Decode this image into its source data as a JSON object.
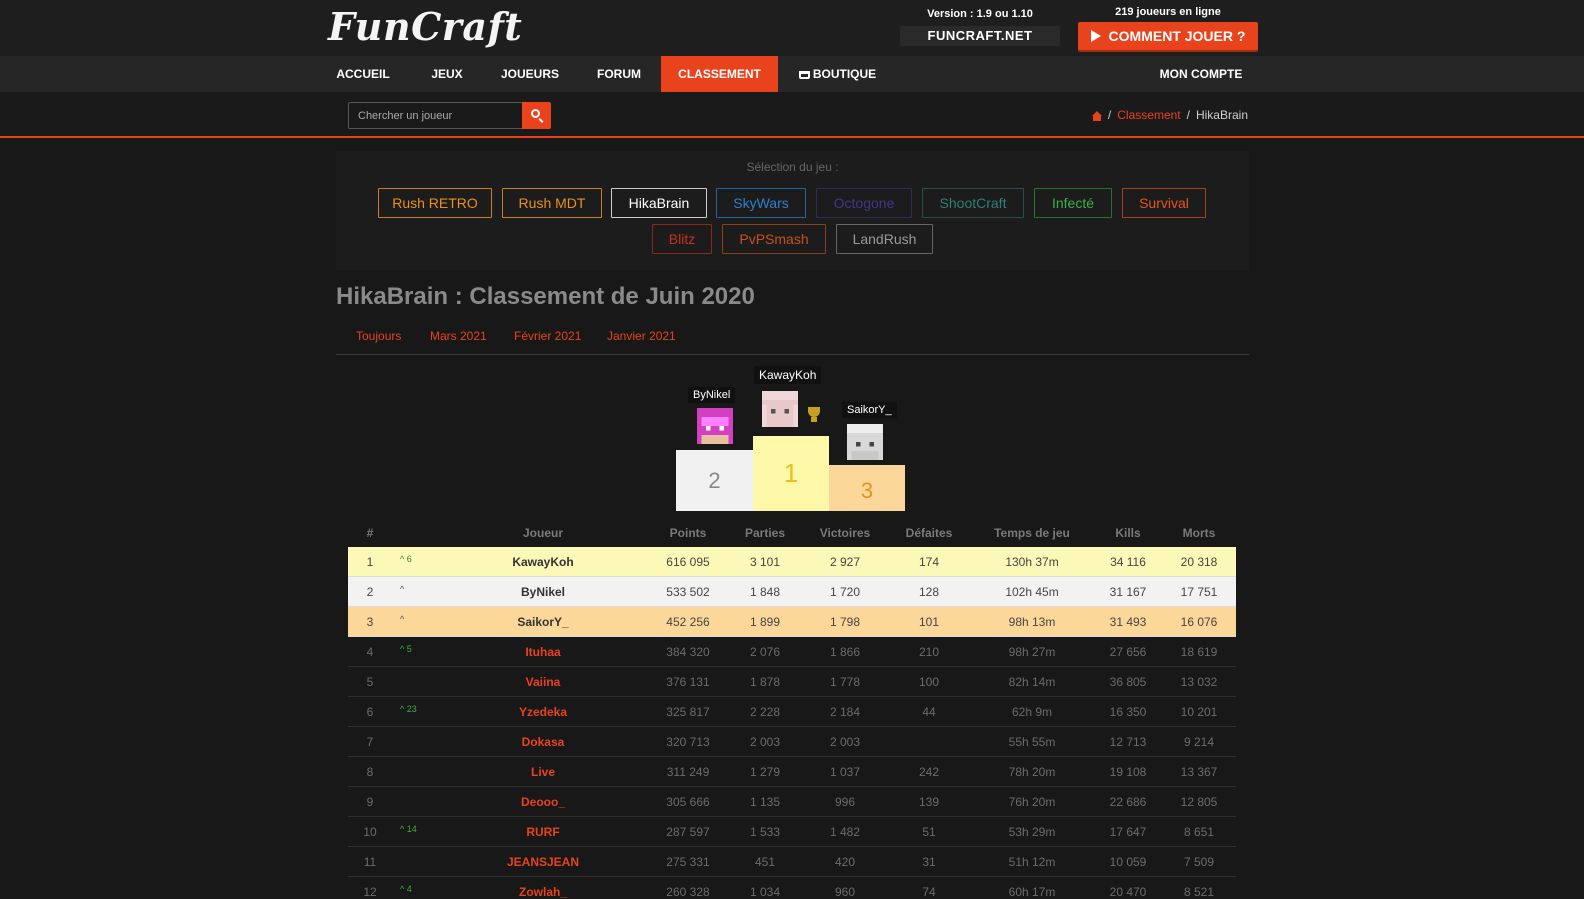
{
  "header": {
    "logo": "FunCraft",
    "version": "Version : 1.9 ou 1.10",
    "server": "FUNCRAFT.NET",
    "online": "219 joueurs en ligne",
    "howto_label": "COMMENT JOUER ?"
  },
  "nav": {
    "items": [
      "ACCUEIL",
      "JEUX",
      "JOUEURS",
      "FORUM",
      "CLASSEMENT",
      "BOUTIQUE"
    ],
    "account": "MON COMPTE"
  },
  "search": {
    "placeholder": "Chercher un joueur"
  },
  "breadcrumb": {
    "level1": "Classement",
    "current": "HikaBrain"
  },
  "games": {
    "label": "Sélection du jeu :",
    "row1": [
      "Rush RETRO",
      "Rush MDT",
      "HikaBrain",
      "SkyWars",
      "Octogone",
      "ShootCraft",
      "Infecté",
      "Survival"
    ],
    "row2": [
      "Blitz",
      "PvPSmash",
      "LandRush"
    ],
    "colors": [
      "#e8901d",
      "#e8901d",
      "#ffffff",
      "#2f7fd0",
      "#3a3a8a",
      "#2f6f6a",
      "#3cb043",
      "#e8431d",
      "#c8301d",
      "#c8501d",
      "#9a9a9a"
    ]
  },
  "title": "HikaBrain : Classement de Juin 2020",
  "periods": [
    "Toujours",
    "Mars 2021",
    "Février 2021",
    "Janvier 2021"
  ],
  "podium": {
    "first": {
      "name": "KawayKoh",
      "rank": "1"
    },
    "second": {
      "name": "ByNikel",
      "rank": "2"
    },
    "third": {
      "name": "SaikorY_",
      "rank": "3"
    }
  },
  "table": {
    "headers": [
      "#",
      "Joueur",
      "Points",
      "Parties",
      "Victoires",
      "Défaites",
      "Temps de jeu",
      "Kills",
      "Morts"
    ],
    "rows": [
      [
        "1",
        "^ 6",
        "KawayKoh",
        "616 095",
        "3 101",
        "2 927",
        "174",
        "130h 37m",
        "34 116",
        "20 318"
      ],
      [
        "2",
        "^",
        "ByNikel",
        "533 502",
        "1 848",
        "1 720",
        "128",
        "102h 45m",
        "31 167",
        "17 751"
      ],
      [
        "3",
        "^",
        "SaikorY_",
        "452 256",
        "1 899",
        "1 798",
        "101",
        "98h 13m",
        "31 493",
        "16 076"
      ],
      [
        "4",
        "^ 5",
        "Ituhaa",
        "384 320",
        "2 076",
        "1 866",
        "210",
        "98h 27m",
        "27 656",
        "18 619"
      ],
      [
        "5",
        "",
        "Vaiina",
        "376 131",
        "1 878",
        "1 778",
        "100",
        "82h 14m",
        "36 805",
        "13 032"
      ],
      [
        "6",
        "^ 23",
        "Yzedeka",
        "325 817",
        "2 228",
        "2 184",
        "44",
        "62h 9m",
        "16 350",
        "10 201"
      ],
      [
        "7",
        "",
        "Dokasa",
        "320 713",
        "2 003",
        "2 003",
        "",
        "55h 55m",
        "12 713",
        "9 214"
      ],
      [
        "8",
        "",
        "Live",
        "311 249",
        "1 279",
        "1 037",
        "242",
        "78h 20m",
        "19 108",
        "13 367"
      ],
      [
        "9",
        "",
        "Deooo_",
        "305 666",
        "1 135",
        "996",
        "139",
        "76h 20m",
        "22 686",
        "12 805"
      ],
      [
        "10",
        "^ 14",
        "RURF",
        "287 597",
        "1 533",
        "1 482",
        "51",
        "53h 29m",
        "17 647",
        "8 651"
      ],
      [
        "11",
        "",
        "JEANSJEAN",
        "275 331",
        "451",
        "420",
        "31",
        "51h 12m",
        "10 059",
        "7 509"
      ],
      [
        "12",
        "^ 4",
        "Zowlah_",
        "260 328",
        "1 034",
        "960",
        "74",
        "60h 17m",
        "20 470",
        "8 521"
      ]
    ]
  }
}
